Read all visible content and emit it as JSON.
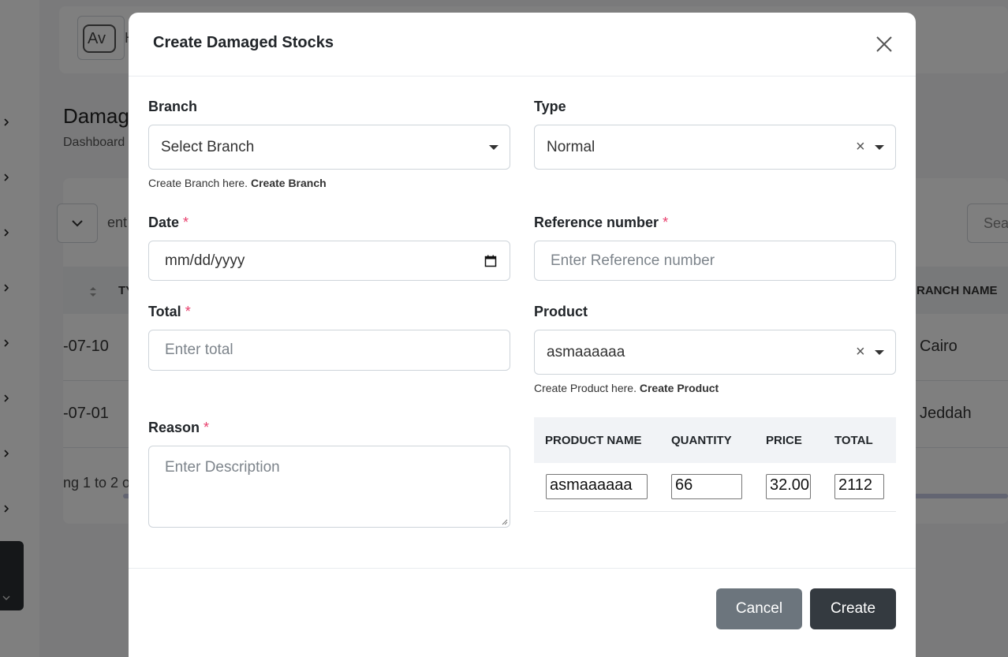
{
  "background": {
    "topbar": {
      "avatar_alt": "Av",
      "initial": "H"
    },
    "page_title": "Damag",
    "breadcrumb": "Dashboard",
    "entries_text": "ent",
    "search_placeholder": "Sea",
    "table": {
      "col_type": "TY",
      "col_branch": "RANCH NAME",
      "rows": [
        {
          "date": "-07-10",
          "branch": "Cairo"
        },
        {
          "date": "-07-01",
          "branch": "Jeddah"
        }
      ]
    },
    "showing_text": "ng 1 to 2 o"
  },
  "modal": {
    "title": "Create Damaged Stocks",
    "branch": {
      "label": "Branch",
      "value": "Select Branch",
      "help_text": "Create Branch here.",
      "help_link": "Create Branch"
    },
    "type": {
      "label": "Type",
      "value": "Normal"
    },
    "date": {
      "label": "Date",
      "required_mark": "*",
      "placeholder": "mm/dd/yyyy"
    },
    "reference": {
      "label": "Reference number",
      "required_mark": "*",
      "placeholder": "Enter Reference number"
    },
    "total": {
      "label": "Total",
      "required_mark": "*",
      "placeholder": "Enter total"
    },
    "product": {
      "label": "Product",
      "value": "asmaaaaaa",
      "help_text": "Create Product here.",
      "help_link": "Create Product"
    },
    "reason": {
      "label": "Reason",
      "required_mark": "*",
      "placeholder": "Enter Description"
    },
    "product_table": {
      "headers": [
        "PRODUCT NAME",
        "QUANTITY",
        "PRICE",
        "TOTAL"
      ],
      "rows": [
        {
          "name": "asmaaaaaa",
          "quantity": "66",
          "price": "32.00",
          "total": "2112"
        }
      ]
    },
    "buttons": {
      "cancel": "Cancel",
      "create": "Create"
    }
  }
}
